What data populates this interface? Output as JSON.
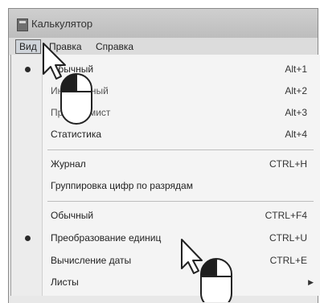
{
  "window": {
    "title": "Калькулятор"
  },
  "menubar": {
    "items": [
      {
        "label": "Вид"
      },
      {
        "label": "Правка"
      },
      {
        "label": "Справка"
      }
    ]
  },
  "dropdown": {
    "groups": [
      [
        {
          "label": "Обычный",
          "shortcut": "Alt+1",
          "checked": true
        },
        {
          "label": "Инженерный",
          "shortcut": "Alt+2",
          "checked": false,
          "obscured": true
        },
        {
          "label": "Программист",
          "shortcut": "Alt+3",
          "checked": false,
          "obscured": true
        },
        {
          "label": "Статистика",
          "shortcut": "Alt+4",
          "checked": false
        }
      ],
      [
        {
          "label": "Журнал",
          "shortcut": "CTRL+H",
          "checked": false
        },
        {
          "label": "Группировка цифр по разрядам",
          "shortcut": "",
          "checked": false
        }
      ],
      [
        {
          "label": "Обычный",
          "shortcut": "CTRL+F4",
          "checked": false
        },
        {
          "label": "Преобразование единиц",
          "shortcut": "CTRL+U",
          "checked": true
        },
        {
          "label": "Вычисление даты",
          "shortcut": "CTRL+E",
          "checked": false
        },
        {
          "label": "Листы",
          "shortcut": "",
          "checked": false,
          "submenu": true
        }
      ]
    ]
  },
  "icons": {
    "app": "calculator-icon",
    "cursor": "mouse-pointer-icon",
    "mouse": "mouse-left-click-icon",
    "submenu": "submenu-arrow-icon"
  }
}
